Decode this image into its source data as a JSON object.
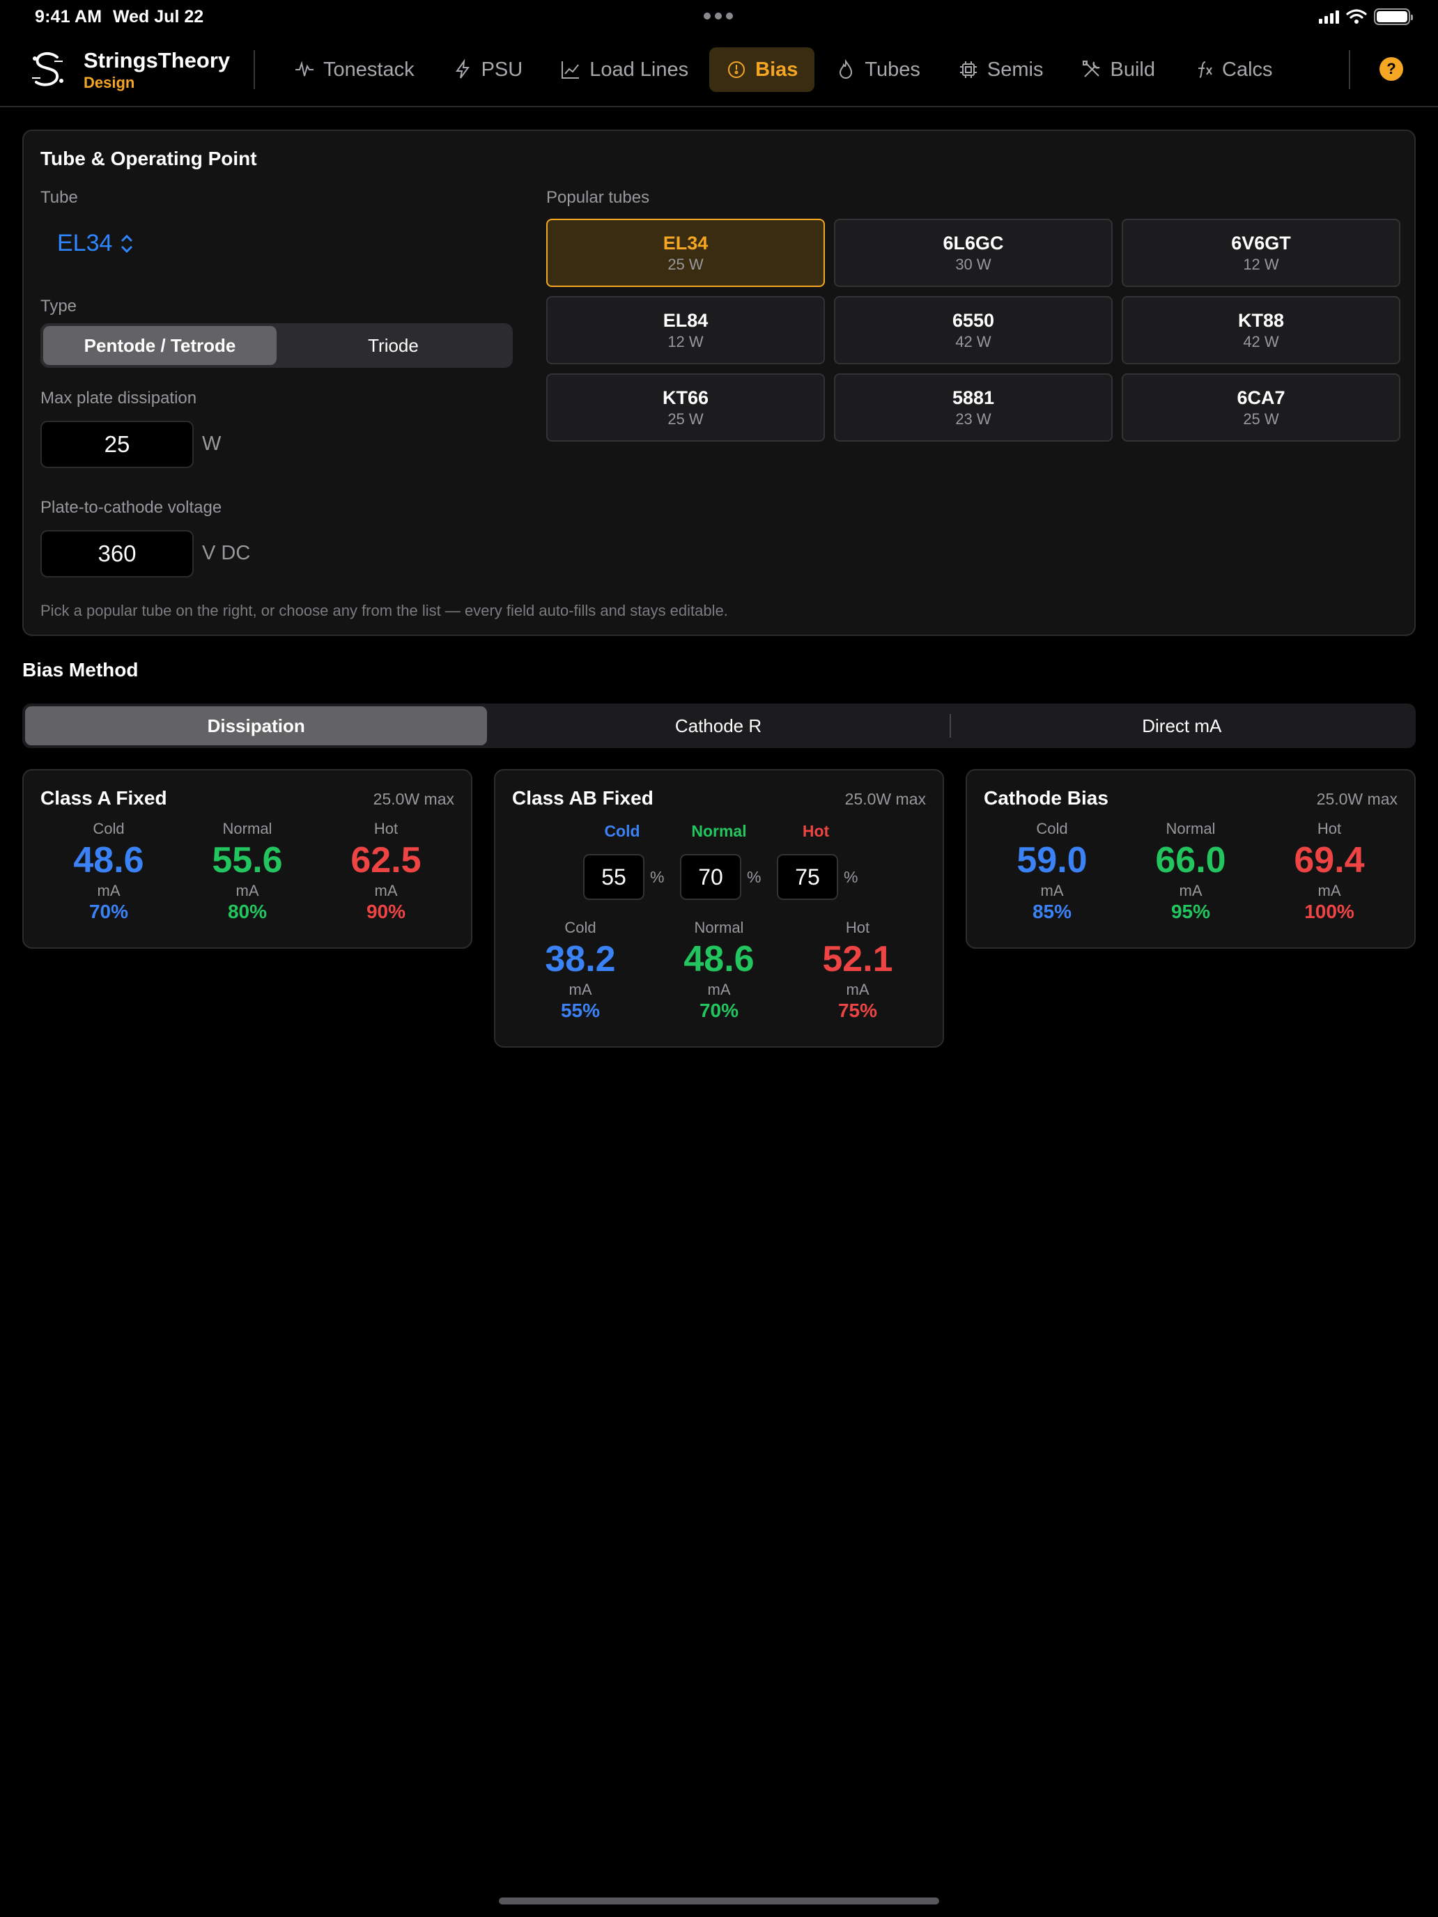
{
  "status_bar": {
    "time": "9:41 AM",
    "date": "Wed Jul 22",
    "battery_level": 1.0
  },
  "nav": {
    "brand": {
      "name": "StringsTheory",
      "subtitle": "Design"
    },
    "tabs": [
      {
        "label": "Tonestack",
        "icon": "waveform-icon"
      },
      {
        "label": "PSU",
        "icon": "bolt-icon"
      },
      {
        "label": "Load Lines",
        "icon": "line-chart-icon"
      },
      {
        "label": "Bias",
        "icon": "gauge-icon",
        "active": true
      },
      {
        "label": "Tubes",
        "icon": "flame-icon"
      },
      {
        "label": "Semis",
        "icon": "chip-icon"
      },
      {
        "label": "Build",
        "icon": "tools-icon"
      },
      {
        "label": "Calcs",
        "icon": "function-icon"
      }
    ],
    "help": "?"
  },
  "panel": {
    "title": "Tube & Operating Point",
    "tube_label": "Tube",
    "tube_value": "EL34",
    "type_label": "Type",
    "type_options": [
      "Pentode / Tetrode",
      "Triode"
    ],
    "type_selected": "Pentode / Tetrode",
    "dissipation_label": "Max plate dissipation",
    "dissipation_value": "25",
    "dissipation_unit": "W",
    "voltage_label": "Plate-to-cathode voltage",
    "voltage_value": "360",
    "voltage_unit": "V DC",
    "popular_label": "Popular tubes",
    "popular_tubes": [
      {
        "name": "EL34",
        "watts": "25 W",
        "selected": true
      },
      {
        "name": "6L6GC",
        "watts": "30 W"
      },
      {
        "name": "6V6GT",
        "watts": "12 W"
      },
      {
        "name": "EL84",
        "watts": "12 W"
      },
      {
        "name": "6550",
        "watts": "42 W"
      },
      {
        "name": "KT88",
        "watts": "42 W"
      },
      {
        "name": "KT66",
        "watts": "25 W"
      },
      {
        "name": "5881",
        "watts": "23 W"
      },
      {
        "name": "6CA7",
        "watts": "25 W"
      }
    ],
    "hint": "Pick a popular tube on the right, or choose any from the list — every field auto-fills and stays editable."
  },
  "bias_method": {
    "title": "Bias Method",
    "options": [
      "Dissipation",
      "Cathode R",
      "Direct mA"
    ],
    "selected": "Dissipation"
  },
  "cards": {
    "class_a": {
      "title": "Class A Fixed",
      "max": "25.0W max",
      "cold": {
        "label": "Cold",
        "value": "48.6",
        "unit": "mA",
        "pct": "70%"
      },
      "normal": {
        "label": "Normal",
        "value": "55.6",
        "unit": "mA",
        "pct": "80%"
      },
      "hot": {
        "label": "Hot",
        "value": "62.5",
        "unit": "mA",
        "pct": "90%"
      }
    },
    "class_ab": {
      "title": "Class AB Fixed",
      "max": "25.0W max",
      "inputs": {
        "cold": {
          "label": "Cold",
          "value": "55"
        },
        "normal": {
          "label": "Normal",
          "value": "70"
        },
        "hot": {
          "label": "Hot",
          "value": "75"
        },
        "pct_sign": "%"
      },
      "cold": {
        "label": "Cold",
        "value": "38.2",
        "unit": "mA",
        "pct": "55%"
      },
      "normal": {
        "label": "Normal",
        "value": "48.6",
        "unit": "mA",
        "pct": "70%"
      },
      "hot": {
        "label": "Hot",
        "value": "52.1",
        "unit": "mA",
        "pct": "75%"
      }
    },
    "cathode": {
      "title": "Cathode Bias",
      "max": "25.0W max",
      "cold": {
        "label": "Cold",
        "value": "59.0",
        "unit": "mA",
        "pct": "85%"
      },
      "normal": {
        "label": "Normal",
        "value": "66.0",
        "unit": "mA",
        "pct": "95%"
      },
      "hot": {
        "label": "Hot",
        "value": "69.4",
        "unit": "mA",
        "pct": "100%"
      }
    }
  },
  "colors": {
    "accent": "#f5a623",
    "link": "#2f86ff",
    "cold": "#3b82f6",
    "normal": "#22c55e",
    "hot": "#ef4444"
  }
}
